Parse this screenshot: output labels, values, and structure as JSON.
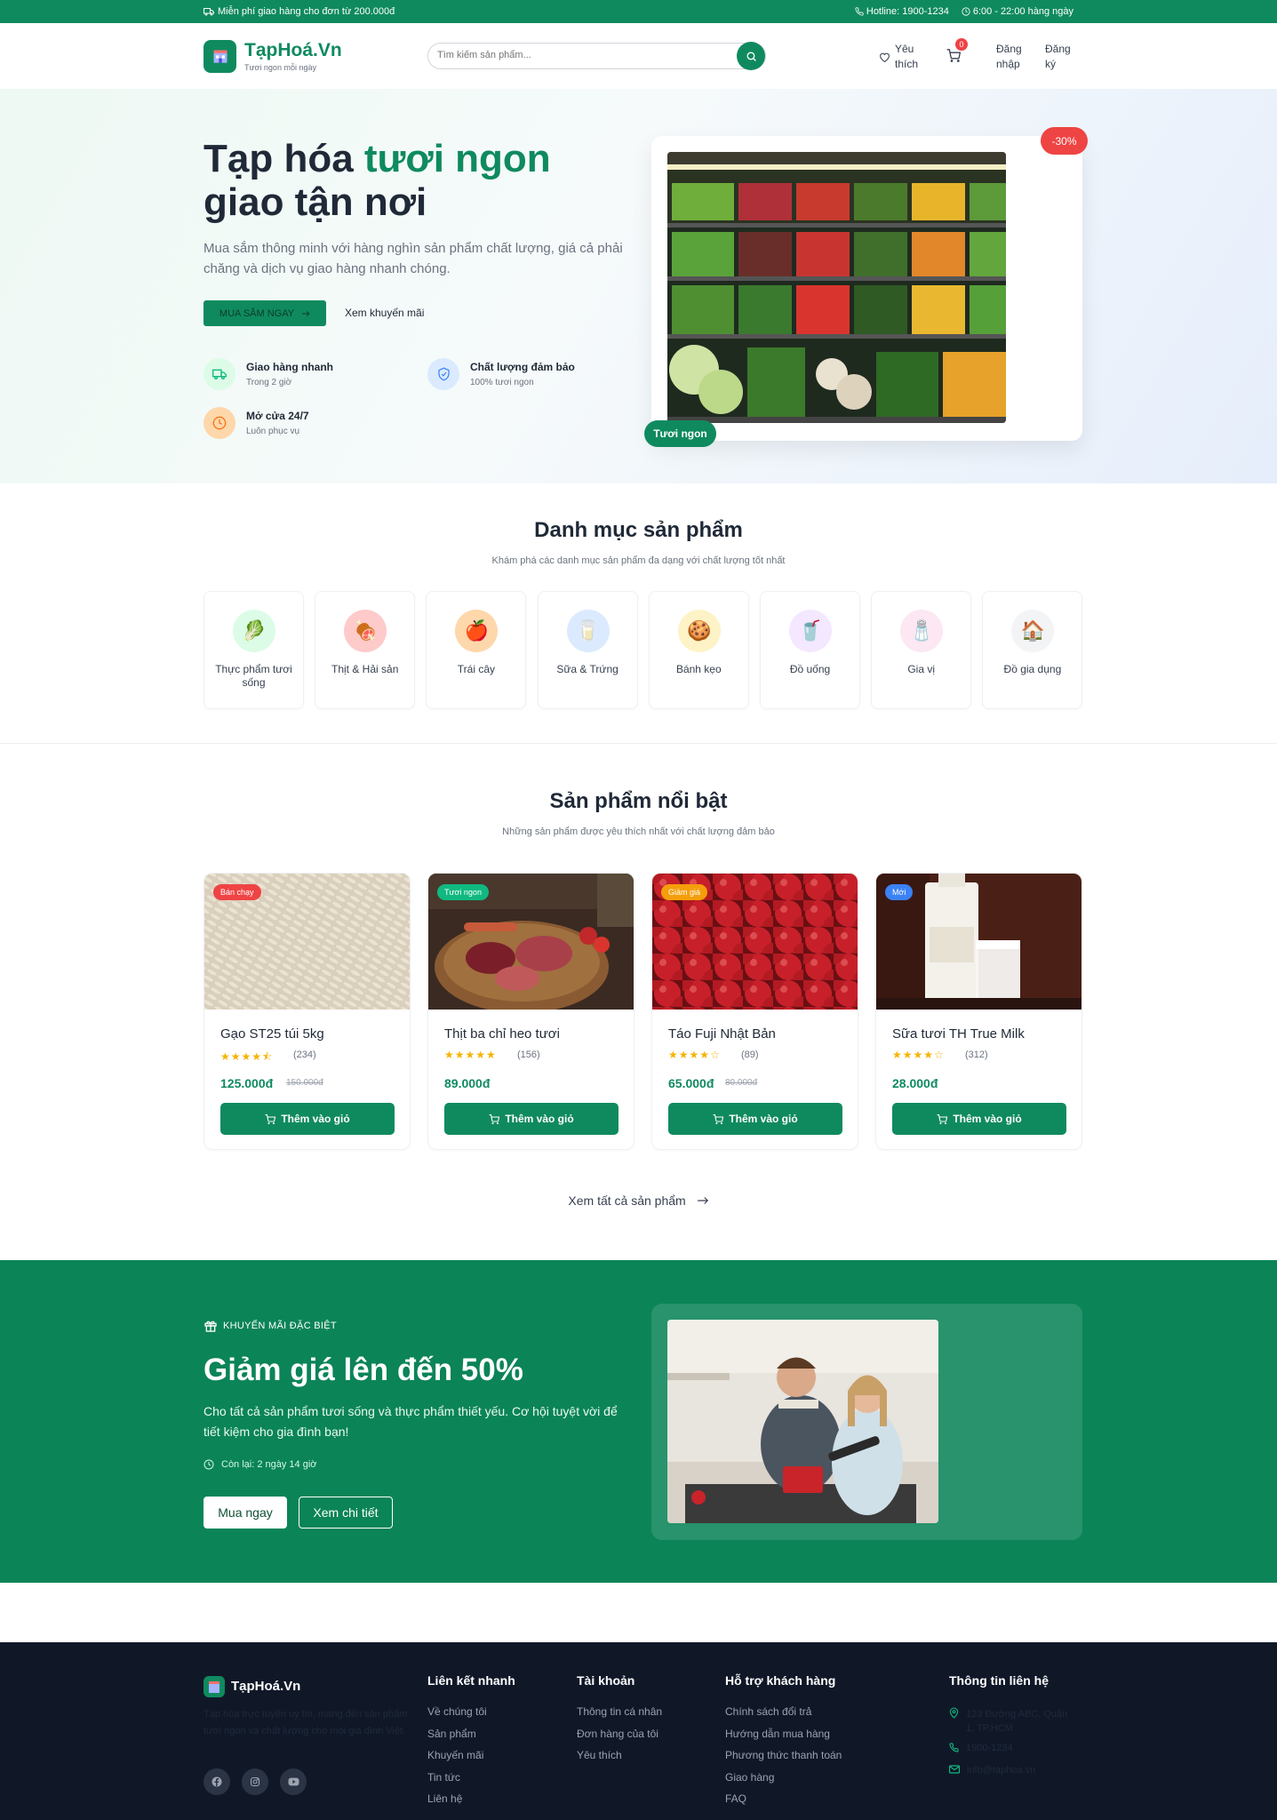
{
  "topbar": {
    "shipping": "Miễn phí giao hàng cho đơn từ 200.000đ",
    "hotline": "Hotline: 1900-1234",
    "hours": "6:00 - 22:00 hàng ngày"
  },
  "header": {
    "logo_title": "TạpHoá.Vn",
    "logo_sub": "Tươi ngon mỗi ngày",
    "search_placeholder": "Tìm kiếm sản phẩm...",
    "wishlist": "Yêu thích",
    "cart_count": "0",
    "login": "Đăng nhập",
    "register": "Đăng ký"
  },
  "hero": {
    "title_1": "Tạp hóa ",
    "title_highlight": "tươi ngon",
    "title_2": "giao tận nơi",
    "desc": "Mua sắm thông minh với hàng nghìn sản phẩm chất lượng, giá cả phải chăng và dịch vụ giao hàng nhanh chóng.",
    "shop_btn": "MUA SẮM NGAY",
    "promo_link": "Xem khuyến mãi",
    "discount_badge": "-30%",
    "fresh_badge": "Tươi ngon",
    "features": [
      {
        "title": "Giao hàng nhanh",
        "sub": "Trong 2 giờ",
        "icon": "truck-icon"
      },
      {
        "title": "Chất lượng đảm bảo",
        "sub": "100% tươi ngon",
        "icon": "shield-icon"
      },
      {
        "title": "Mở cửa 24/7",
        "sub": "Luôn phục vụ",
        "icon": "clock-icon"
      }
    ]
  },
  "categories": {
    "title": "Danh mục sản phẩm",
    "subtitle": "Khám phá các danh mục sản phẩm đa dạng với chất lượng tốt nhất",
    "items": [
      {
        "label": "Thực phẩm tươi sống",
        "icon": "🥬",
        "bg": "#dcfce7"
      },
      {
        "label": "Thịt & Hải sản",
        "icon": "🍖",
        "bg": "#fecaca"
      },
      {
        "label": "Trái cây",
        "icon": "🍎",
        "bg": "#fed7aa"
      },
      {
        "label": "Sữa & Trứng",
        "icon": "🥛",
        "bg": "#dbeafe"
      },
      {
        "label": "Bánh kẹo",
        "icon": "🍪",
        "bg": "#fef3c7"
      },
      {
        "label": "Đồ uống",
        "icon": "🥤",
        "bg": "#f3e8ff"
      },
      {
        "label": "Gia vị",
        "icon": "🧂",
        "bg": "#fce7f3"
      },
      {
        "label": "Đồ gia dụng",
        "icon": "🏠",
        "bg": "#f3f4f6"
      }
    ]
  },
  "featured": {
    "title": "Sản phẩm nổi bật",
    "subtitle": "Những sản phẩm được yêu thích nhất với chất lượng đảm bảo",
    "add_label": "Thêm vào giỏ",
    "see_all": "Xem tất cả sản phẩm",
    "products": [
      {
        "name": "Gạo ST25 túi 5kg",
        "tag": "Bán chạy",
        "tag_color": "#ef4444",
        "stars": "★★★★⯪",
        "reviews": "(234)",
        "price": "125.000đ",
        "old_price": "150.000đ"
      },
      {
        "name": "Thịt ba chỉ heo tươi",
        "tag": "Tươi ngon",
        "tag_color": "#10b981",
        "stars": "★★★★★",
        "reviews": "(156)",
        "price": "89.000đ",
        "old_price": ""
      },
      {
        "name": "Táo Fuji Nhật Bản",
        "tag": "Giảm giá",
        "tag_color": "#f59e0b",
        "stars": "★★★★☆",
        "reviews": "(89)",
        "price": "65.000đ",
        "old_price": "80.000đ"
      },
      {
        "name": "Sữa tươi TH True Milk",
        "tag": "Mới",
        "tag_color": "#3b82f6",
        "stars": "★★★★☆",
        "reviews": "(312)",
        "price": "28.000đ",
        "old_price": ""
      }
    ]
  },
  "promo": {
    "tag": "KHUYẾN MÃI ĐẶC BIỆT",
    "title": "Giảm giá lên đến 50%",
    "desc": "Cho tất cả sản phẩm tươi sống và thực phẩm thiết yếu. Cơ hội tuyệt vời để tiết kiệm cho gia đình bạn!",
    "countdown": "Còn lại: 2 ngày 14 giờ",
    "buy_btn": "Mua ngay",
    "detail_btn": "Xem chi tiết"
  },
  "footer": {
    "logo": "TạpHoá.Vn",
    "desc": "Tạp hóa trực tuyến uy tín, mang đến sản phẩm tươi ngon và chất lượng cho mọi gia đình Việt.",
    "quick_links_title": "Liên kết nhanh",
    "quick_links": [
      "Về chúng tôi",
      "Sản phẩm",
      "Khuyến mãi",
      "Tin tức",
      "Liên hệ"
    ],
    "account_title": "Tài khoản",
    "account_links": [
      "Thông tin cá nhân",
      "Đơn hàng của tôi",
      "Yêu thích"
    ],
    "support_title": "Hỗ trợ khách hàng",
    "support_links": [
      "Chính sách đổi trả",
      "Hướng dẫn mua hàng",
      "Phương thức thanh toán",
      "Giao hàng",
      "FAQ"
    ],
    "contact_title": "Thông tin liên hệ",
    "contact_address": "123 Đường ABC, Quận 1, TP.HCM",
    "contact_phone": "1900-1234",
    "contact_email": "info@taphoa.vn"
  }
}
